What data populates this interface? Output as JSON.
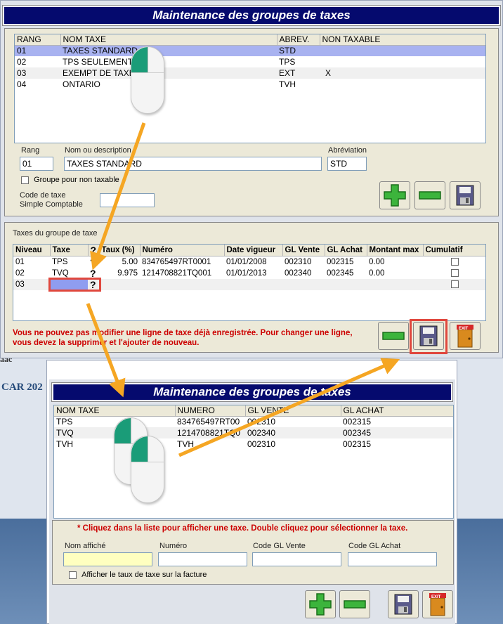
{
  "top_window": {
    "title": "Maintenance des groupes de taxes",
    "groups_table": {
      "headers": [
        "RANG",
        "NOM TAXE",
        "ABREV.",
        "NON TAXABLE"
      ],
      "rows": [
        [
          "01",
          "TAXES STANDARD",
          "STD",
          ""
        ],
        [
          "02",
          "TPS SEULEMENT",
          "TPS",
          ""
        ],
        [
          "03",
          "EXEMPT DE TAXE",
          "EXT",
          "X"
        ],
        [
          "04",
          "ONTARIO",
          "TVH",
          ""
        ]
      ],
      "selected_index": 0
    },
    "form": {
      "rang_label": "Rang",
      "rang_value": "01",
      "nom_label": "Nom ou description",
      "nom_value": "TAXES STANDARD",
      "abrev_label": "Abréviation",
      "abrev_value": "STD",
      "non_taxable_label": "Groupe pour non taxable",
      "code_label_1": "Code de taxe",
      "code_label_2": "Simple Comptable",
      "code_value": ""
    },
    "taxes_section": {
      "title": "Taxes du groupe de taxe",
      "headers": [
        "Niveau",
        "Taxe",
        "?",
        "Taux (%)",
        "Numéro",
        "Date vigueur",
        "GL Vente",
        "GL Achat",
        "Montant max",
        "Cumulatif"
      ],
      "rows": [
        {
          "niveau": "01",
          "taxe": "TPS",
          "q": "?",
          "taux": "5.00",
          "numero": "834765497RT0001",
          "date": "01/01/2008",
          "gl_vente": "002310",
          "gl_achat": "002315",
          "montant": "0.00"
        },
        {
          "niveau": "02",
          "taxe": "TVQ",
          "q": "?",
          "taux": "9.975",
          "numero": "1214708821TQ001",
          "date": "01/01/2013",
          "gl_vente": "002340",
          "gl_achat": "002345",
          "montant": "0.00"
        },
        {
          "niveau": "03",
          "taxe": "",
          "q": "?",
          "taux": "",
          "numero": "",
          "date": "",
          "gl_vente": "",
          "gl_achat": "",
          "montant": ""
        }
      ],
      "message_line1": "Vous ne pouvez pas modifier une ligne de taxe déjà enregistrée. Pour changer une ligne,",
      "message_line2": "vous devez la supprimer et l'ajouter de nouveau."
    },
    "exit_label": "EXIT"
  },
  "background_text": {
    "car": "CAR 202"
  },
  "bottom_window": {
    "title": "Maintenance des groupes de taxes",
    "headers": [
      "NOM TAXE",
      "NUMERO",
      "GL VENTE",
      "GL ACHAT"
    ],
    "rows": [
      [
        "TPS",
        "834765497RT00",
        "002310",
        "002315"
      ],
      [
        "TVQ",
        "1214708821TQ0",
        "002340",
        "002345"
      ],
      [
        "TVH",
        "TVH",
        "002310",
        "002315"
      ]
    ],
    "message": "* Cliquez dans la liste pour afficher une taxe. Double cliquez pour sélectionner la taxe.",
    "fields": {
      "nom_label": "Nom affiché",
      "numero_label": "Numéro",
      "gl_vente_label": "Code GL Vente",
      "gl_achat_label": "Code GL Achat"
    },
    "checkbox_label": "Afficher le taux de taxe sur la facture",
    "exit_label": "EXIT"
  },
  "colors": {
    "title_bg": "#050a6e",
    "selection": "#a8b2f0",
    "arrow": "#f5a623",
    "highlight_box": "#e0473d",
    "plus_green": "#3cb43c"
  }
}
